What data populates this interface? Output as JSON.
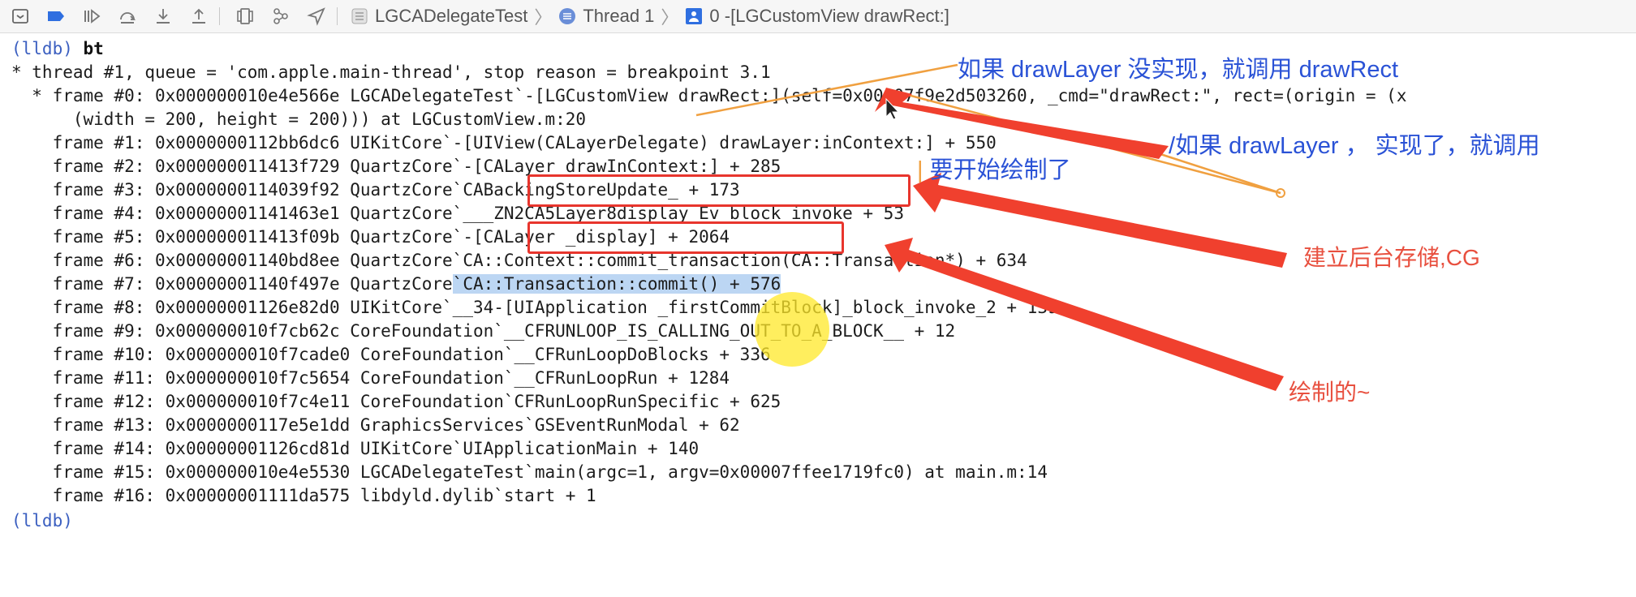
{
  "toolbar": {
    "icons": [
      "hide-console-icon",
      "breakpoint-icon",
      "continue-icon",
      "step-over-icon",
      "step-into-icon",
      "step-out-icon",
      "view-hierarchy-icon",
      "memory-graph-icon",
      "location-icon"
    ],
    "breadcrumbs": [
      {
        "label": "LGCADelegateTest",
        "icon": "app-icon"
      },
      {
        "label": "Thread 1",
        "icon": "thread-icon"
      },
      {
        "label": "0 -[LGCustomView drawRect:]",
        "icon": "frame-icon"
      }
    ]
  },
  "console": {
    "prompt": "(lldb)",
    "command": "bt",
    "thread_line": "* thread #1, queue = 'com.apple.main-thread', stop reason = breakpoint 3.1",
    "frame0_line1": "  * frame #0: 0x000000010e4e566e LGCADelegateTest`-[LGCustomView drawRect:](self=0x00007f9e2d503260, _cmd=\"drawRect:\", rect=(origin = (x",
    "frame0_line2": "      (width = 200, height = 200))) at LGCustomView.m:20",
    "frames": [
      {
        "num": "frame #1: ",
        "addr": "0x0000000112bb6dc6 ",
        "module": "UIKitCore",
        "symbol": "`-[UIView(CALayerDelegate) drawLayer:inContext:] + 550"
      },
      {
        "num": "frame #2: ",
        "addr": "0x000000011413f729 ",
        "module": "QuartzCore",
        "symbol": "`-[CALayer drawInContext:] + 285"
      },
      {
        "num": "frame #3: ",
        "addr": "0x0000000114039f92 ",
        "module": "QuartzCore",
        "symbol": "`CABackingStoreUpdate_ + 173"
      },
      {
        "num": "frame #4: ",
        "addr": "0x00000001141463e1 ",
        "module": "QuartzCore",
        "symbol": "`___ZN2CA5Layer8display_Ev_block_invoke + 53"
      },
      {
        "num": "frame #5: ",
        "addr": "0x000000011413f09b ",
        "module": "QuartzCore",
        "symbol": "`-[CALayer _display] + 2064"
      },
      {
        "num": "frame #6: ",
        "addr": "0x00000001140bd8ee ",
        "module": "QuartzCore",
        "symbol": "`CA::Context::commit_transaction(CA::Transaction*) + 634"
      },
      {
        "num": "frame #7: ",
        "addr": "0x00000001140f497e ",
        "module": "QuartzCore",
        "symbol": "`CA::Transaction::commit() + 576"
      },
      {
        "num": "frame #8: ",
        "addr": "0x00000001126e82d0 ",
        "module": "UIKitCore",
        "symbol": "`__34-[UIApplication _firstCommitBlock]_block_invoke_2 + 139"
      },
      {
        "num": "frame #9: ",
        "addr": "0x000000010f7cb62c ",
        "module": "CoreFoundation",
        "symbol": "`__CFRUNLOOP_IS_CALLING_OUT_TO_A_BLOCK__ + 12"
      },
      {
        "num": "frame #10: ",
        "addr": "0x000000010f7cade0 ",
        "module": "CoreFoundation",
        "symbol": "`__CFRunLoopDoBlocks + 336"
      },
      {
        "num": "frame #11: ",
        "addr": "0x000000010f7c5654 ",
        "module": "CoreFoundation",
        "symbol": "`__CFRunLoopRun + 1284"
      },
      {
        "num": "frame #12: ",
        "addr": "0x000000010f7c4e11 ",
        "module": "CoreFoundation",
        "symbol": "`CFRunLoopRunSpecific + 625"
      },
      {
        "num": "frame #13: ",
        "addr": "0x0000000117e5e1dd ",
        "module": "GraphicsServices",
        "symbol": "`GSEventRunModal + 62"
      },
      {
        "num": "frame #14: ",
        "addr": "0x00000001126cd81d ",
        "module": "UIKitCore",
        "symbol": "`UIApplicationMain + 140"
      },
      {
        "num": "frame #15: ",
        "addr": "0x000000010e4e5530 ",
        "module": "LGCADelegateTest",
        "symbol": "`main(argc=1, argv=0x00007ffee1719fc0) at main.m:14"
      },
      {
        "num": "frame #16: ",
        "addr": "0x00000001111da575 ",
        "module": "libdyld.dylib",
        "symbol": "`start + 1"
      }
    ],
    "end_prompt": "(lldb)"
  },
  "annotations": {
    "draw_rect_note": "如果 drawLayer 没实现，就调用 drawRect",
    "draw_layer_note": "如果 drawLayer ， 实现了，就调用",
    "start_drawing_note": "要开始绘制了",
    "backing_store_note": "建立后台存储,CG",
    "drawing_note": "绘制的~"
  },
  "colors": {
    "prompt": "#3b5fc0",
    "highlight": "#bcd6f3",
    "annotation_blue": "#2a52d6",
    "annotation_red": "#e8503f",
    "arrow_red": "#f0402e",
    "arrow_orange": "#f0a040"
  }
}
